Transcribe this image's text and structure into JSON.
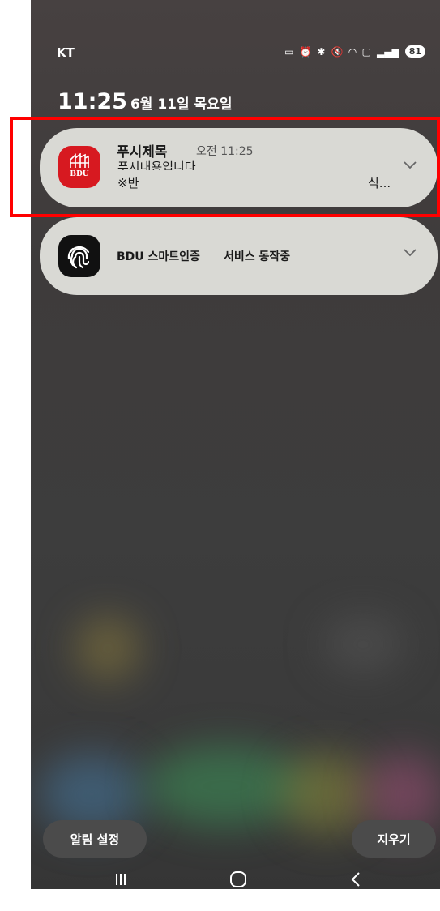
{
  "status_bar": {
    "carrier": "KT",
    "battery": "81",
    "icons": [
      "nfc-icon",
      "alarm-icon",
      "bluetooth-icon",
      "mute-icon",
      "wifi-icon",
      "hd-icon",
      "signal-icon",
      "battery-icon"
    ]
  },
  "clock": {
    "time": "11:25",
    "date": "6월 11일 목요일"
  },
  "notifications": [
    {
      "app_icon": "bdu-logo-icon",
      "logo_text": "BDU",
      "title": "푸시제목",
      "time": "오전 11:25",
      "body_line1": "푸시내용입니다",
      "body_line2_start": "※반",
      "body_line2_end": "식..."
    },
    {
      "app_icon": "fingerprint-icon",
      "app_name": "BDU 스마트인증",
      "text": "서비스 동작중"
    }
  ],
  "buttons": {
    "notification_settings": "알림 설정",
    "clear": "지우기"
  },
  "navigation": [
    "recent-apps-icon",
    "home-icon",
    "back-icon"
  ],
  "colors": {
    "highlight": "#ff0000",
    "bdu_red": "#d71920"
  }
}
